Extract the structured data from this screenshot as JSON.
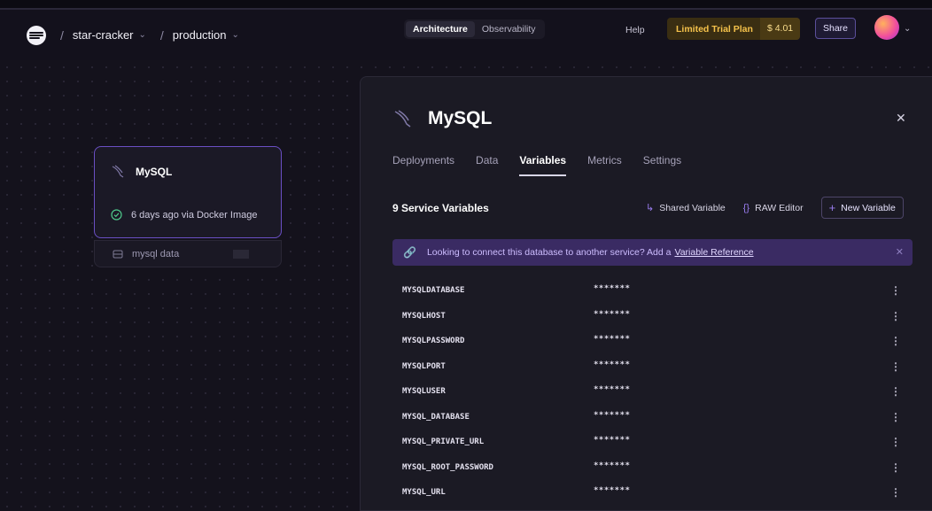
{
  "header": {
    "project": "star-cracker",
    "environment": "production",
    "tabs": [
      "Architecture",
      "Observability"
    ],
    "help": "Help",
    "plan": "Limited Trial Plan",
    "credit": "$ 4.01",
    "share": "Share"
  },
  "node": {
    "title": "MySQL",
    "status": "6 days ago via Docker Image",
    "volume": "mysql data"
  },
  "panel": {
    "title": "MySQL",
    "tabs": [
      "Deployments",
      "Data",
      "Variables",
      "Metrics",
      "Settings"
    ],
    "active_tab": "Variables",
    "variables_title": "9 Service Variables",
    "actions": {
      "shared_variable": "Shared Variable",
      "raw_editor": "RAW Editor",
      "new_variable": "New Variable"
    },
    "banner": {
      "text": "Looking to connect this database to another service? Add a",
      "link": "Variable Reference"
    },
    "variables": [
      {
        "key": "MYSQLDATABASE",
        "value": "*******"
      },
      {
        "key": "MYSQLHOST",
        "value": "*******"
      },
      {
        "key": "MYSQLPASSWORD",
        "value": "*******"
      },
      {
        "key": "MYSQLPORT",
        "value": "*******"
      },
      {
        "key": "MYSQLUSER",
        "value": "*******"
      },
      {
        "key": "MYSQL_DATABASE",
        "value": "*******"
      },
      {
        "key": "MYSQL_PRIVATE_URL",
        "value": "*******"
      },
      {
        "key": "MYSQL_ROOT_PASSWORD",
        "value": "*******"
      },
      {
        "key": "MYSQL_URL",
        "value": "*******"
      }
    ]
  },
  "colors": {
    "accent": "#6a4fc4",
    "banner": "#3a2b63",
    "trial": "#f5c24b"
  },
  "icons": [
    "railway-logo-icon",
    "chevron-down-icon",
    "mysql-dolphin-icon",
    "check-circle-icon",
    "volume-icon",
    "close-icon",
    "shared-arrow-icon",
    "braces-icon",
    "plus-icon",
    "link-icon",
    "kebab-menu-icon"
  ]
}
